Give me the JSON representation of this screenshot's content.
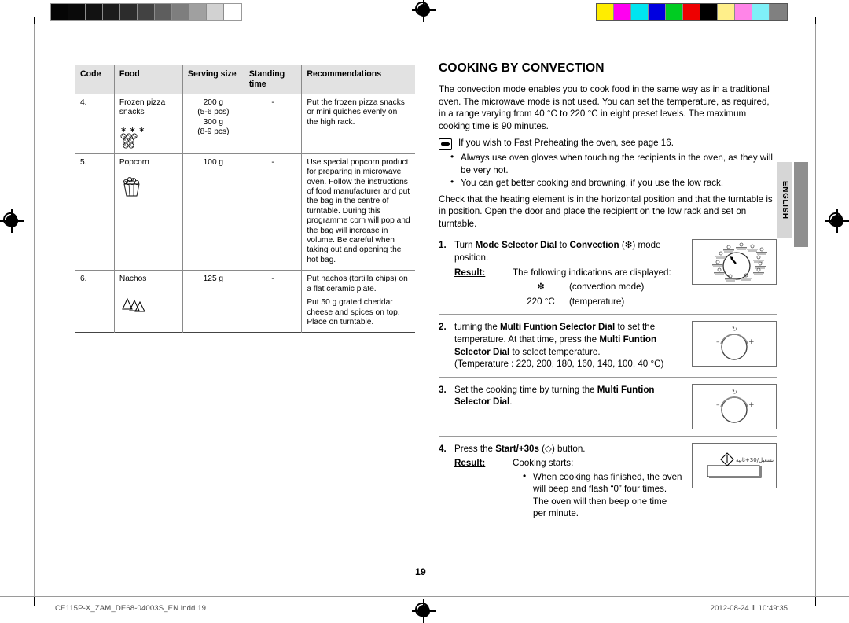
{
  "print_marks": {
    "gray_swatches": [
      "#050505",
      "#0a0a0a",
      "#121212",
      "#1c1c1c",
      "#2c2c2c",
      "#424242",
      "#5e5e5e",
      "#7e7e7e",
      "#a0a0a0",
      "#d2d2d2",
      "#ffffff"
    ],
    "color_swatches": [
      "#ffed00",
      "#ff00f0",
      "#00e5f0",
      "#0000e0",
      "#00cc22",
      "#ee0000",
      "#000000",
      "#ffef8a",
      "#ff85e8",
      "#7ff0f8",
      "#808080"
    ],
    "registration_icon": "registration-target-icon"
  },
  "table": {
    "headers": [
      "Code",
      "Food",
      "Serving size",
      "Standing time",
      "Recommendations"
    ],
    "rows": [
      {
        "code": "4.",
        "food": "Frozen pizza snacks",
        "icon": "pizza-snacks-icon",
        "serving_size": "200 g\n(5-6 pcs)\n300 g\n(8-9 pcs)",
        "standing_time": "-",
        "recommendations": "Put the frozen pizza snacks or mini quiches evenly on the high rack."
      },
      {
        "code": "5.",
        "food": "Popcorn",
        "icon": "popcorn-bag-icon",
        "serving_size": "100 g",
        "standing_time": "-",
        "recommendations": "Use special popcorn product for preparing in microwave oven. Follow the instructions of food manufacturer and put the bag in the centre of turntable. During this programme corn will pop and the bag will increase in volume. Be careful when taking out and opening the hot bag."
      },
      {
        "code": "6.",
        "food": "Nachos",
        "icon": "nachos-chips-icon",
        "serving_size": "125 g",
        "standing_time": "-",
        "recommendations": "Put nachos (tortilla chips) on a flat ceramic plate.\nPut 50 g grated cheddar cheese and spices on top. Place on turntable."
      }
    ]
  },
  "section": {
    "title": "COOKING BY CONVECTION",
    "intro": "The convection mode enables you to cook food in the same way as in a traditional oven. The microwave mode is not used. You can set the temperature, as required, in a range varying from 40 °C to 220 °C in eight preset levels. The maximum cooking time is 90 minutes.",
    "note_icon": "pointing-hand-icon",
    "note": "If you wish to Fast Preheating the oven, see page 16.",
    "bullets": [
      "Always use oven gloves when touching the recipients in the oven, as they will be very hot.",
      "You can get better cooking and browning, if you use the low rack."
    ],
    "after_bullets": "Check that the heating element is in the horizontal position and that the turntable is in position. Open the door and place the recipient on the low rack and set on turntable."
  },
  "steps": [
    {
      "num": "1.",
      "text_parts": [
        {
          "t": "Turn ",
          "b": false
        },
        {
          "t": "Mode Selector Dial",
          "b": true
        },
        {
          "t": " to ",
          "b": false
        },
        {
          "t": "Convection",
          "b": true
        },
        {
          "t": " (✻) mode position.",
          "b": false
        }
      ],
      "result_label": "Result:",
      "result_text": "The following indications are displayed:",
      "indications": [
        {
          "key": "✻",
          "val": "(convection mode)"
        },
        {
          "key": "220 °C",
          "val": "(temperature)"
        }
      ],
      "illustration": "mode-selector-dial-diagram"
    },
    {
      "num": "2.",
      "text_parts": [
        {
          "t": "turning the ",
          "b": false
        },
        {
          "t": "Multi Funtion Selector Dial",
          "b": true
        },
        {
          "t": " to set the temperature. At that time, press the ",
          "b": false
        },
        {
          "t": "Multi Funtion Selector Dial",
          "b": true
        },
        {
          "t": " to select temperature.",
          "b": false
        }
      ],
      "extra_line": "(Temperature : 220, 200, 180, 160, 140, 100, 40 °C)",
      "illustration": "multi-function-selector-dial-diagram"
    },
    {
      "num": "3.",
      "text_parts": [
        {
          "t": "Set the cooking time by turning the ",
          "b": false
        },
        {
          "t": "Multi Funtion Selector Dial",
          "b": true
        },
        {
          "t": ".",
          "b": false
        }
      ],
      "illustration": "multi-function-selector-dial-diagram"
    },
    {
      "num": "4.",
      "text_parts": [
        {
          "t": "Press the ",
          "b": false
        },
        {
          "t": "Start/+30s",
          "b": true
        },
        {
          "t": " (◇) button.",
          "b": false
        }
      ],
      "result_label": "Result:",
      "result_text": "Cooking starts:",
      "result_bullets": [
        "When cooking has finished, the oven will beep and flash “0” four times. The oven will then beep one time per minute."
      ],
      "illustration": "start-plus-30s-button-diagram",
      "illustration_caption": "تشغيل/30+ثانية"
    }
  ],
  "language_tab": "ENGLISH",
  "page_number": "19",
  "footer": {
    "file": "CE115P-X_ZAM_DE68-04003S_EN.indd   19",
    "date": "2012-08-24   Ⅲ 10:49:35"
  }
}
